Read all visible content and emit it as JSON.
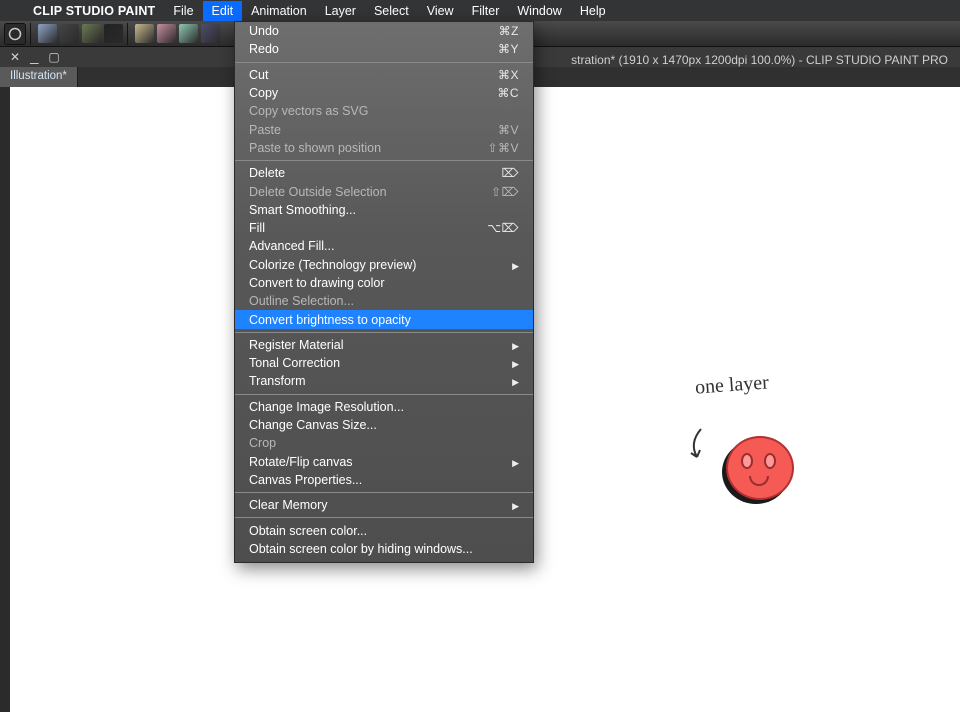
{
  "app_name": "CLIP STUDIO PAINT",
  "menubar": [
    "File",
    "Edit",
    "Animation",
    "Layer",
    "Select",
    "View",
    "Filter",
    "Window",
    "Help"
  ],
  "menubar_active": "Edit",
  "window_title_right": "stration* (1910 x 1470px 1200dpi 100.0%)  - CLIP STUDIO PAINT PRO",
  "tab": {
    "label": "Illustration*"
  },
  "canvas_text": "one layer",
  "dropdown": {
    "groups": [
      [
        {
          "label": "Undo",
          "hint": "⌘Z"
        },
        {
          "label": "Redo",
          "hint": "⌘Y"
        }
      ],
      [
        {
          "label": "Cut",
          "hint": "⌘X"
        },
        {
          "label": "Copy",
          "hint": "⌘C"
        },
        {
          "label": "Copy vectors as SVG",
          "disabled": true
        },
        {
          "label": "Paste",
          "hint": "⌘V",
          "disabled": true
        },
        {
          "label": "Paste to shown position",
          "hint": "⇧⌘V",
          "disabled": true
        }
      ],
      [
        {
          "label": "Delete",
          "hint": "⌦"
        },
        {
          "label": "Delete Outside Selection",
          "hint": "⇧⌦",
          "disabled": true
        },
        {
          "label": "Smart Smoothing..."
        },
        {
          "label": "Fill",
          "hint": "⌥⌦"
        },
        {
          "label": "Advanced Fill..."
        },
        {
          "label": "Colorize (Technology preview)",
          "submenu": true
        },
        {
          "label": "Convert to drawing color"
        },
        {
          "label": "Outline Selection...",
          "disabled": true
        },
        {
          "label": "Convert brightness to opacity",
          "highlight": true
        }
      ],
      [
        {
          "label": "Register Material",
          "submenu": true
        },
        {
          "label": "Tonal Correction",
          "submenu": true
        },
        {
          "label": "Transform",
          "submenu": true
        }
      ],
      [
        {
          "label": "Change Image Resolution..."
        },
        {
          "label": "Change Canvas Size..."
        },
        {
          "label": "Crop",
          "disabled": true
        },
        {
          "label": "Rotate/Flip canvas",
          "submenu": true
        },
        {
          "label": "Canvas Properties..."
        }
      ],
      [
        {
          "label": "Clear Memory",
          "submenu": true
        }
      ],
      [
        {
          "label": "Obtain screen color..."
        },
        {
          "label": "Obtain screen color by hiding windows..."
        }
      ]
    ]
  },
  "toolbar_avatars_colors": [
    "#8fa4c9",
    "#444",
    "#6b7a55",
    "#222",
    "#c9b98f",
    "#c98fa0",
    "#8fc9b1",
    "#4e4e6e"
  ]
}
